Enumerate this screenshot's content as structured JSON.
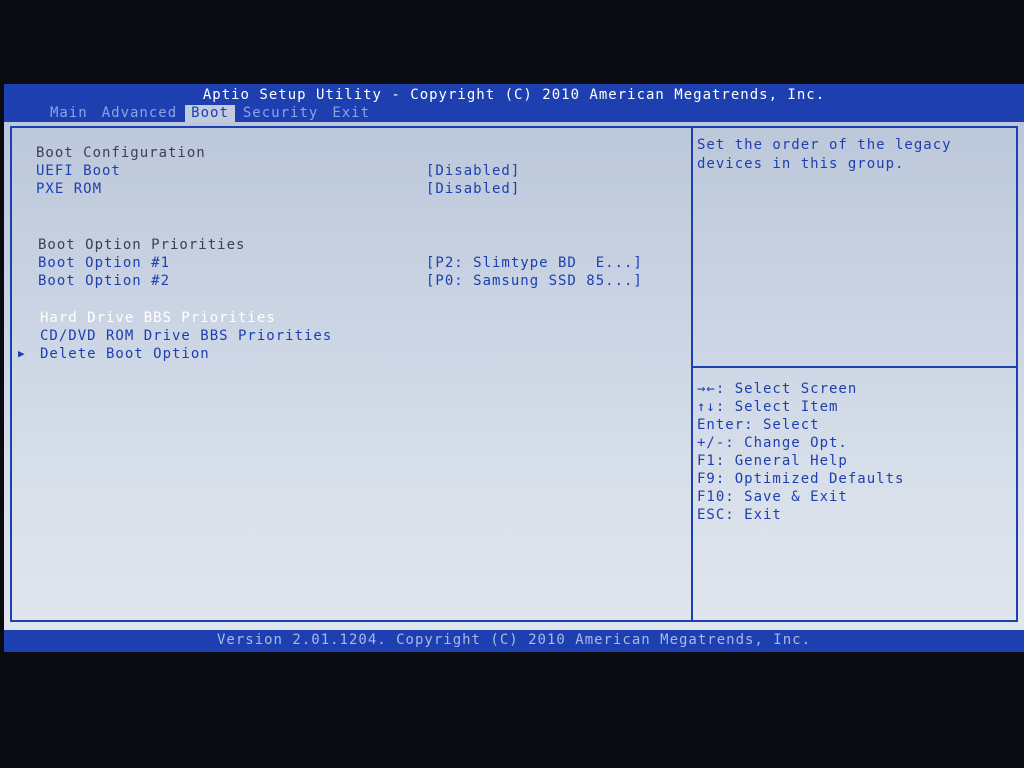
{
  "app_title": "Aptio Setup Utility - Copyright (C) 2010 American Megatrends, Inc.",
  "tabs": [
    {
      "label": "Main",
      "active": false
    },
    {
      "label": "Advanced",
      "active": false
    },
    {
      "label": "Boot",
      "active": true
    },
    {
      "label": "Security",
      "active": false
    },
    {
      "label": "Exit",
      "active": false
    }
  ],
  "boot": {
    "config_heading": "Boot Configuration",
    "uefi_boot": {
      "label": "UEFI Boot",
      "value": "[Disabled]"
    },
    "pxe_rom": {
      "label": "PXE ROM",
      "value": "[Disabled]"
    },
    "priorities_heading": "Boot Option Priorities",
    "boot_option_1": {
      "label": "Boot Option #1",
      "value": "[P2: Slimtype BD  E...]"
    },
    "boot_option_2": {
      "label": "Boot Option #2",
      "value": "[P0: Samsung SSD 85...]"
    },
    "hdd_bbs": "Hard Drive BBS Priorities",
    "cddvd_bbs": "CD/DVD ROM Drive BBS Priorities",
    "delete_boot": "Delete Boot Option"
  },
  "help": {
    "line1": "Set the order of the legacy",
    "line2": "devices in this group."
  },
  "keys": [
    "→←: Select Screen",
    "↑↓: Select Item",
    "Enter: Select",
    "+/-: Change Opt.",
    "F1: General Help",
    "F9: Optimized Defaults",
    "F10: Save & Exit",
    "ESC: Exit"
  ],
  "footer": "Version 2.01.1204. Copyright (C) 2010 American Megatrends, Inc.",
  "colors": {
    "bios_blue": "#1d3fb0",
    "panel_gray": "#c8d2e2",
    "selected_text": "#ffffff"
  }
}
